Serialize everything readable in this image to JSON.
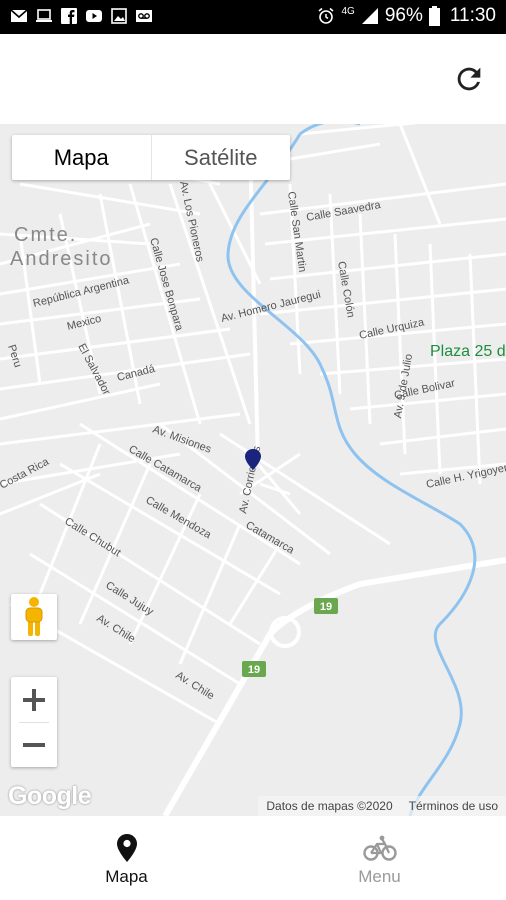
{
  "status_bar": {
    "battery": "96%",
    "time": "11:30",
    "network": "4G",
    "left_icons": [
      "gmail-icon",
      "laptop-icon",
      "facebook-icon",
      "youtube-icon",
      "gallery-icon",
      "voicemail-icon"
    ],
    "right_icons": [
      "alarm-icon",
      "signal-icon",
      "battery-icon"
    ]
  },
  "app_bar": {
    "refresh_icon": "refresh-icon"
  },
  "map": {
    "type_control": {
      "mapa_label": "Mapa",
      "satelite_label": "Satélite",
      "selected": "Mapa"
    },
    "district_label_line1": "Cmte.",
    "district_label_line2": "Andresito",
    "place_label": "Plaza 25 d",
    "route_badges": [
      "19",
      "19"
    ],
    "streets": [
      "Calle Saavedra",
      "Calle San Martin",
      "Calle Colón",
      "Calle Urquiza",
      "Calle Bolivar",
      "Av. 9 de Julio",
      "Calle H. Yrigoyen",
      "Av. Los Pioneros",
      "Calle Jose Bonpara",
      "República Argentina",
      "Mexico",
      "Av. Homero Jauregui",
      "Canadá",
      "Peru",
      "El Salvador",
      "Av. Misiones",
      "Av. Corrientes",
      "Calle Catamarca",
      "Costa Rica",
      "Calle Mendoza",
      "Catamarca",
      "Calle Chubut",
      "Calle Jujuy",
      "Av. Chile",
      "Av. Chile"
    ],
    "marker_color": "#1a237e",
    "google_logo": "Google",
    "attribution": "Datos de mapas ©2020",
    "terms": "Términos de uso"
  },
  "colors": {
    "map_background": "#ededed",
    "road": "#ffffff",
    "river": "#8ec3f0",
    "route_badge": "#6aa84f",
    "park_text": "#1e8e3e"
  },
  "bottom_nav": {
    "items": [
      {
        "label": "Mapa",
        "icon": "location-pin-icon",
        "active": true
      },
      {
        "label": "Menu",
        "icon": "bicycle-icon",
        "active": false
      }
    ]
  }
}
